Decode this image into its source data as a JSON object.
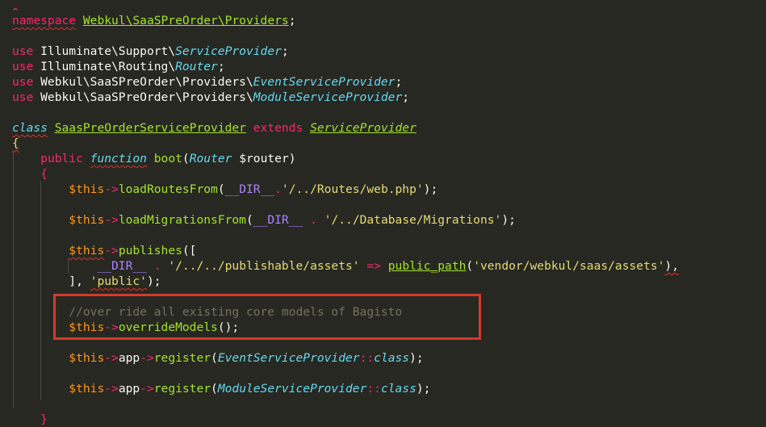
{
  "editor": {
    "lines": [
      [
        {
          "t": "namespace",
          "c": "kw sq"
        },
        {
          "t": " "
        },
        {
          "t": "Webkul\\SaaSPreOrder\\Providers",
          "c": "fn-u"
        },
        {
          "t": ";"
        }
      ],
      [],
      [
        {
          "t": "use",
          "c": "kw"
        },
        {
          "t": " Illuminate\\Support\\"
        },
        {
          "t": "ServiceProvider",
          "c": "cls"
        },
        {
          "t": ";"
        }
      ],
      [
        {
          "t": "use",
          "c": "kw"
        },
        {
          "t": " Illuminate\\Routing\\"
        },
        {
          "t": "Router",
          "c": "cls"
        },
        {
          "t": ";"
        }
      ],
      [
        {
          "t": "use",
          "c": "kw"
        },
        {
          "t": " Webkul\\SaaSPreOrder\\Providers\\"
        },
        {
          "t": "EventServiceProvider",
          "c": "cls"
        },
        {
          "t": ";"
        }
      ],
      [
        {
          "t": "use",
          "c": "kw"
        },
        {
          "t": " Webkul\\SaaSPreOrder\\Providers\\"
        },
        {
          "t": "ModuleServiceProvider",
          "c": "cls"
        },
        {
          "t": ";"
        }
      ],
      [],
      [
        {
          "t": "class",
          "c": "cls sq"
        },
        {
          "t": " "
        },
        {
          "t": "SaasPreOrderServiceProvider",
          "c": "fn-u"
        },
        {
          "t": " "
        },
        {
          "t": "extends",
          "c": "kw"
        },
        {
          "t": " "
        },
        {
          "t": "ServiceProvider",
          "c": "fn-u ital"
        }
      ],
      [
        {
          "t": "{",
          "c": "brace sq"
        }
      ],
      [
        {
          "t": "    "
        },
        {
          "t": "public",
          "c": "kw"
        },
        {
          "t": " "
        },
        {
          "t": "function",
          "c": "cls sq"
        },
        {
          "t": " "
        },
        {
          "t": "boot",
          "c": "fn"
        },
        {
          "t": "("
        },
        {
          "t": "Router",
          "c": "cls"
        },
        {
          "t": " $router)"
        }
      ],
      [
        {
          "t": "    "
        },
        {
          "t": "{",
          "c": "kw"
        }
      ],
      [
        {
          "t": "        "
        },
        {
          "t": "$this",
          "c": "var"
        },
        {
          "t": "->",
          "c": "kw"
        },
        {
          "t": "loadRoutesFrom",
          "c": "fn"
        },
        {
          "t": "("
        },
        {
          "t": "__DIR__",
          "c": "con"
        },
        {
          "t": ".",
          "c": "kw"
        },
        {
          "t": "'/../Routes/web.php'",
          "c": "str"
        },
        {
          "t": ");"
        }
      ],
      [],
      [
        {
          "t": "        "
        },
        {
          "t": "$this",
          "c": "var"
        },
        {
          "t": "->",
          "c": "kw"
        },
        {
          "t": "loadMigrationsFrom",
          "c": "fn"
        },
        {
          "t": "("
        },
        {
          "t": "__DIR__",
          "c": "con"
        },
        {
          "t": " "
        },
        {
          "t": ".",
          "c": "kw"
        },
        {
          "t": " "
        },
        {
          "t": "'/../Database/Migrations'",
          "c": "str"
        },
        {
          "t": ");"
        }
      ],
      [],
      [
        {
          "t": "        "
        },
        {
          "t": "$this",
          "c": "var sq"
        },
        {
          "t": "->",
          "c": "kw"
        },
        {
          "t": "publishes",
          "c": "fn"
        },
        {
          "t": "(["
        }
      ],
      [
        {
          "t": "            "
        },
        {
          "t": "__DIR__",
          "c": "con"
        },
        {
          "t": " "
        },
        {
          "t": ".",
          "c": "kw"
        },
        {
          "t": " "
        },
        {
          "t": "'/../../publishable/assets'",
          "c": "str"
        },
        {
          "t": " "
        },
        {
          "t": "=>",
          "c": "kw"
        },
        {
          "t": " "
        },
        {
          "t": "public_path",
          "c": "fn-u"
        },
        {
          "t": "("
        },
        {
          "t": "'vendor/webkul/saas/assets'",
          "c": "str"
        },
        {
          "t": "),",
          "c": "sq"
        }
      ],
      [
        {
          "t": "        ], "
        },
        {
          "t": "'public'",
          "c": "str sq"
        },
        {
          "t": ");"
        }
      ],
      [],
      [
        {
          "t": "        "
        },
        {
          "t": "//over ride all existing core models of Bagisto",
          "c": "cmt"
        }
      ],
      [
        {
          "t": "        "
        },
        {
          "t": "$this",
          "c": "var"
        },
        {
          "t": "->",
          "c": "kw"
        },
        {
          "t": "overrideModels",
          "c": "fn"
        },
        {
          "t": "();"
        }
      ],
      [],
      [
        {
          "t": "        "
        },
        {
          "t": "$this",
          "c": "var"
        },
        {
          "t": "->",
          "c": "kw"
        },
        {
          "t": "app"
        },
        {
          "t": "->",
          "c": "kw"
        },
        {
          "t": "register",
          "c": "fn"
        },
        {
          "t": "("
        },
        {
          "t": "EventServiceProvider",
          "c": "cls"
        },
        {
          "t": "::",
          "c": "kw"
        },
        {
          "t": "class",
          "c": "cls"
        },
        {
          "t": ");"
        }
      ],
      [],
      [
        {
          "t": "        "
        },
        {
          "t": "$this",
          "c": "var"
        },
        {
          "t": "->",
          "c": "kw"
        },
        {
          "t": "app"
        },
        {
          "t": "->",
          "c": "kw"
        },
        {
          "t": "register",
          "c": "fn"
        },
        {
          "t": "("
        },
        {
          "t": "ModuleServiceProvider",
          "c": "cls"
        },
        {
          "t": "::",
          "c": "kw"
        },
        {
          "t": "class",
          "c": "cls"
        },
        {
          "t": ");"
        }
      ],
      [],
      [
        {
          "t": "    "
        },
        {
          "t": "}",
          "c": "kw"
        }
      ]
    ]
  },
  "colors": {
    "background": "#272822",
    "highlight_border": "#d23a2e"
  }
}
